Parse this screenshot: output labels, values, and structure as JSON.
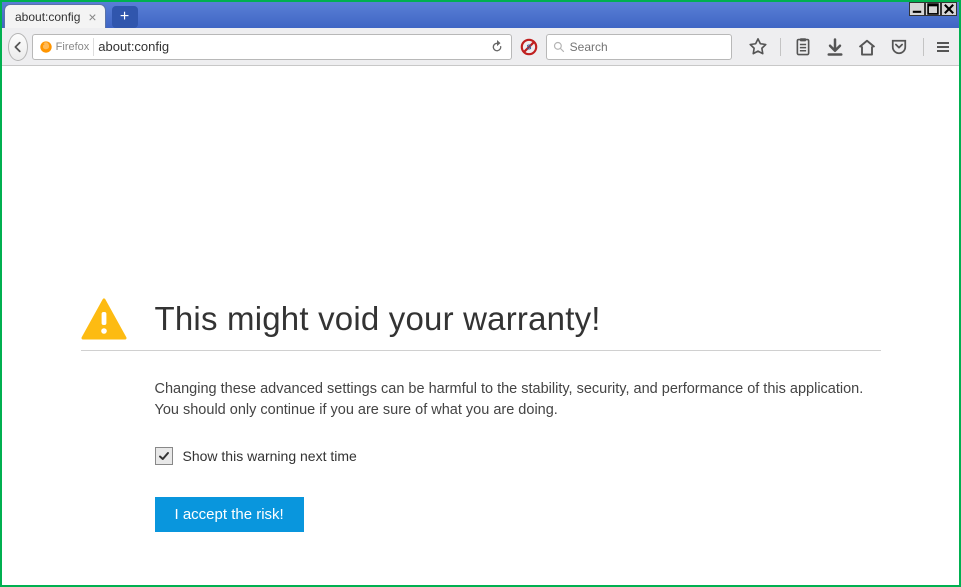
{
  "tab": {
    "title": "about:config"
  },
  "urlbar": {
    "identity": "Firefox",
    "value": "about:config"
  },
  "searchbar": {
    "placeholder": "Search"
  },
  "warning": {
    "title": "This might void your warranty!",
    "body": "Changing these advanced settings can be harmful to the stability, security, and performance of this application. You should only continue if you are sure of what you are doing.",
    "checkbox_label": "Show this warning next time",
    "accept_label": "I accept the risk!"
  }
}
